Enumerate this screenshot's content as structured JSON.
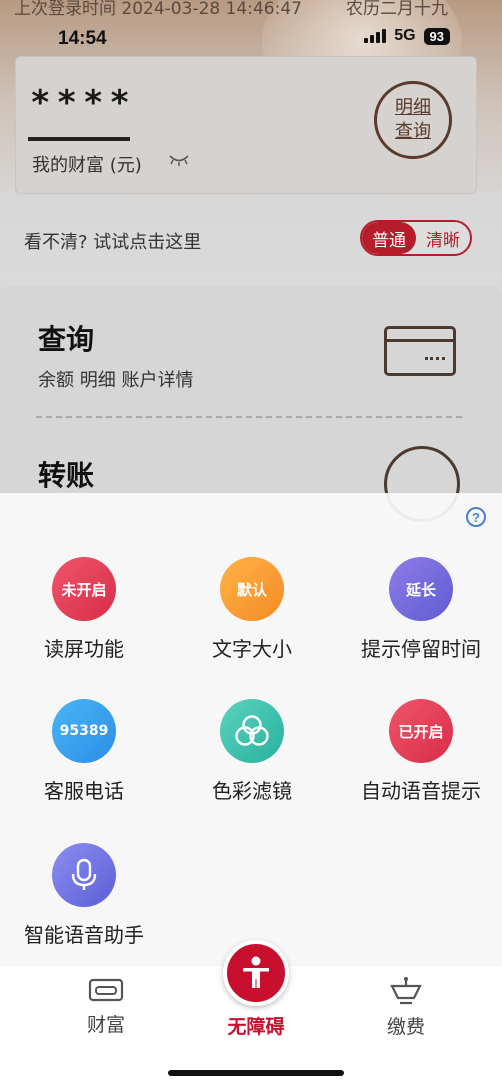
{
  "status_bar": {
    "last_login": "上次登录时间 2024-03-28 14:46:47",
    "lunar_date": "农历二月十九",
    "time": "14:54",
    "network": "5G",
    "battery": "93"
  },
  "wealth": {
    "masked_amount": "****",
    "label": "我的财富 (元)",
    "detail_button_line1": "明细",
    "detail_button_line2": "查询"
  },
  "display_mode": {
    "prompt": "看不清? 试试点击这里",
    "normal": "普通",
    "clear": "清晰"
  },
  "menu": [
    {
      "title": "查询",
      "subtitle": "余额 明细 账户详情"
    },
    {
      "title": "转账",
      "subtitle": ""
    }
  ],
  "accessibility": {
    "features": [
      {
        "badge": "未开启",
        "label": "读屏功能",
        "color": "#e63d58"
      },
      {
        "badge": "默认",
        "label": "文字大小",
        "color": "#f79c35"
      },
      {
        "badge": "延长",
        "label": "提示停留时间",
        "color": "#6f6ad9"
      },
      {
        "badge": "95389",
        "label": "客服电话",
        "color": "#38a0ee"
      },
      {
        "badge": "",
        "label": "色彩滤镜",
        "color": "#3cc2ae"
      },
      {
        "badge": "已开启",
        "label": "自动语音提示",
        "color": "#e63d58"
      },
      {
        "badge": "",
        "label": "智能语音助手",
        "color": "#6f6ad9"
      }
    ]
  },
  "tabbar": {
    "wealth": "财富",
    "accessibility": "无障碍",
    "payment": "缴费"
  }
}
